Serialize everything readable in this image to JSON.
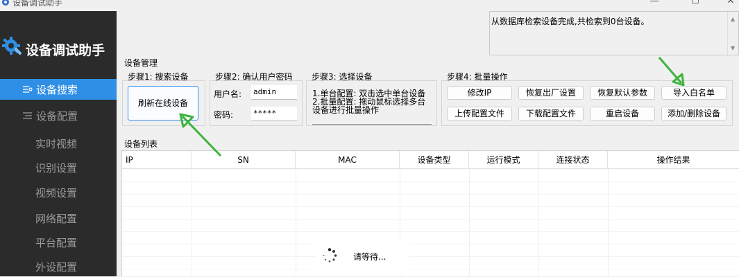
{
  "window": {
    "title": "设备调试助手",
    "minimize": "—",
    "maximize": "☐",
    "close": "✕"
  },
  "sidebar": {
    "brand": "设备调试助手",
    "items": [
      {
        "label": "设备搜索",
        "icon": "list-icon",
        "active": true
      },
      {
        "label": "设备配置",
        "icon": "menu-icon",
        "active": false
      },
      {
        "label": "实时视频",
        "active": false
      },
      {
        "label": "识别设置",
        "active": false
      },
      {
        "label": "视频设置",
        "active": false
      },
      {
        "label": "网络配置",
        "active": false
      },
      {
        "label": "平台配置",
        "active": false
      },
      {
        "label": "外设配置",
        "active": false
      }
    ]
  },
  "log": {
    "text": "从数据库检索设备完成,共检索到0台设备。"
  },
  "device_mgmt": {
    "title": "设备管理",
    "step1": {
      "title": "步骤1: 搜索设备",
      "refresh_button": "刷新在线设备"
    },
    "step2": {
      "title": "步骤2: 确认用户密码",
      "username_label": "用户名:",
      "username_value": "admin",
      "password_label": "密码:",
      "password_value": "*****"
    },
    "step3": {
      "title": "步骤3: 选择设备",
      "text": "1.单台配置: 双击选中单台设备\n2.批量配置: 拖动鼠标选择多台\n设备进行批量操作"
    },
    "step4": {
      "title": "步骤4: 批量操作",
      "buttons": [
        "修改IP",
        "恢复出厂设置",
        "恢复默认参数",
        "导入白名单",
        "上传配置文件",
        "下载配置文件",
        "重启设备",
        "添加/删除设备"
      ]
    }
  },
  "device_list": {
    "title": "设备列表",
    "columns": [
      "IP",
      "SN",
      "MAC",
      "设备类型",
      "运行模式",
      "连接状态",
      "操作结果"
    ],
    "rows": []
  },
  "loading": {
    "text": "请等待..."
  },
  "colors": {
    "sidebar_bg": "#2b2b2b",
    "accent": "#2f8fe6",
    "arrow": "#3cb43c"
  }
}
